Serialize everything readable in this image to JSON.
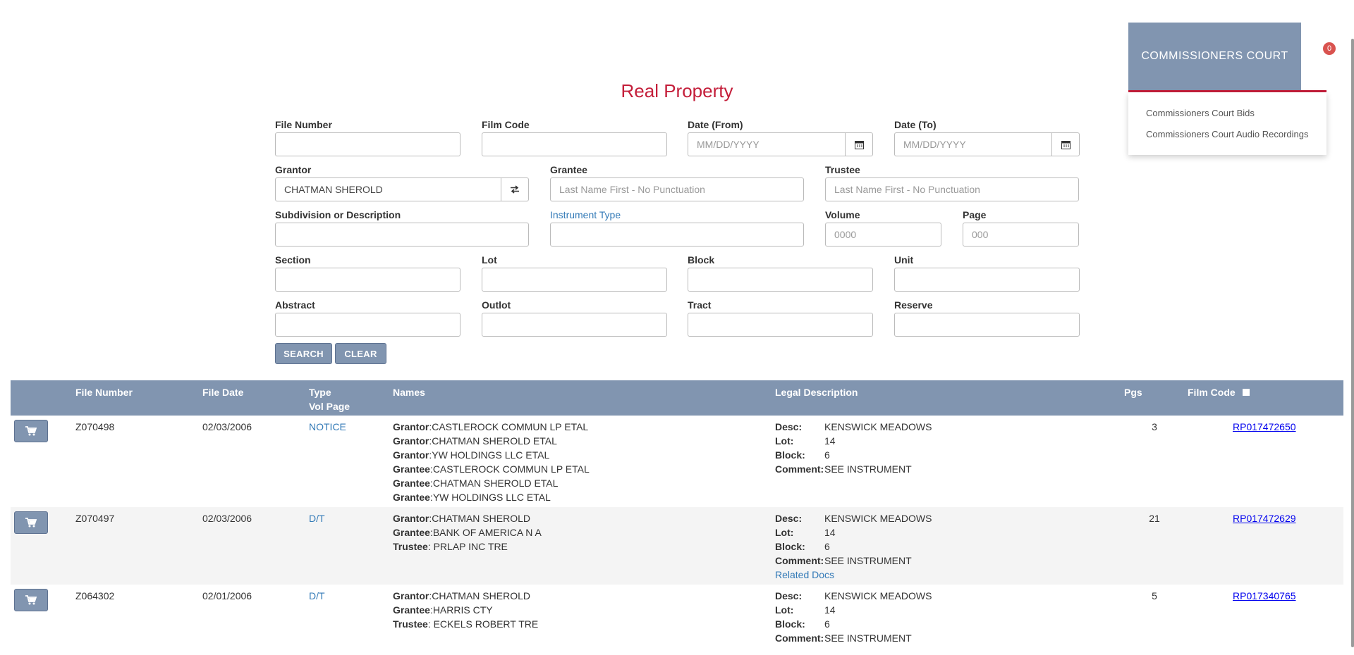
{
  "header": {
    "menu_label": "COMMISSIONERS COURT",
    "badge_count": "0",
    "dropdown_items": [
      "Commissioners Court Bids",
      "Commissioners Court Audio Recordings"
    ]
  },
  "page_title": "Real Property",
  "form": {
    "file_number": {
      "label": "File Number",
      "value": ""
    },
    "film_code": {
      "label": "Film Code",
      "value": ""
    },
    "date_from": {
      "label": "Date (From)",
      "placeholder": "MM/DD/YYYY"
    },
    "date_to": {
      "label": "Date (To)",
      "placeholder": "MM/DD/YYYY"
    },
    "grantor": {
      "label": "Grantor",
      "value": "CHATMAN SHEROLD"
    },
    "grantee": {
      "label": "Grantee",
      "placeholder": "Last Name First - No Punctuation"
    },
    "trustee": {
      "label": "Trustee",
      "placeholder": "Last Name First - No Punctuation"
    },
    "subdivision": {
      "label": "Subdivision or Description",
      "value": ""
    },
    "instrument_type": {
      "label": "Instrument Type",
      "value": ""
    },
    "volume": {
      "label": "Volume",
      "placeholder": "0000"
    },
    "page": {
      "label": "Page",
      "placeholder": "000"
    },
    "section": {
      "label": "Section"
    },
    "lot": {
      "label": "Lot"
    },
    "block": {
      "label": "Block"
    },
    "unit": {
      "label": "Unit"
    },
    "abstract": {
      "label": "Abstract"
    },
    "outlot": {
      "label": "Outlot"
    },
    "tract": {
      "label": "Tract"
    },
    "reserve": {
      "label": "Reserve"
    },
    "search_label": "SEARCH",
    "clear_label": "CLEAR"
  },
  "table": {
    "headers": {
      "file_number": "File Number",
      "file_date": "File Date",
      "type": "Type",
      "vol_page": "Vol Page",
      "names": "Names",
      "legal_description": "Legal Description",
      "pgs": "Pgs",
      "film_code": "Film Code"
    },
    "rows": [
      {
        "file_number": "Z070498",
        "file_date": "02/03/2006",
        "type": "NOTICE",
        "names": [
          {
            "role": "Grantor",
            "sep": ":",
            "name": "CASTLEROCK COMMUN LP ETAL"
          },
          {
            "role": "Grantor",
            "sep": ":",
            "name": "CHATMAN SHEROLD ETAL"
          },
          {
            "role": "Grantor",
            "sep": ":",
            "name": "YW HOLDINGS LLC ETAL"
          },
          {
            "role": "Grantee",
            "sep": ":",
            "name": "CASTLEROCK COMMUN LP ETAL"
          },
          {
            "role": "Grantee",
            "sep": ":",
            "name": "CHATMAN SHEROLD ETAL"
          },
          {
            "role": "Grantee",
            "sep": ":",
            "name": "YW HOLDINGS LLC ETAL"
          }
        ],
        "legal": [
          {
            "label": "Desc:",
            "value": "KENSWICK MEADOWS"
          },
          {
            "label": "Lot:",
            "value": "14"
          },
          {
            "label": "Block:",
            "value": "6"
          },
          {
            "label": "Comment:",
            "value": "SEE INSTRUMENT"
          }
        ],
        "related": "",
        "pgs": "3",
        "film_code": "RP017472650"
      },
      {
        "file_number": "Z070497",
        "file_date": "02/03/2006",
        "type": "D/T",
        "names": [
          {
            "role": "Grantor",
            "sep": ":",
            "name": "CHATMAN SHEROLD"
          },
          {
            "role": "Grantee",
            "sep": ":",
            "name": "BANK OF AMERICA N A"
          },
          {
            "role": "Trustee",
            "sep": ": ",
            "name": "PRLAP INC TRE"
          }
        ],
        "legal": [
          {
            "label": "Desc:",
            "value": "KENSWICK MEADOWS"
          },
          {
            "label": "Lot:",
            "value": "14"
          },
          {
            "label": "Block:",
            "value": "6"
          },
          {
            "label": "Comment:",
            "value": "SEE INSTRUMENT"
          }
        ],
        "related": "Related Docs",
        "pgs": "21",
        "film_code": "RP017472629"
      },
      {
        "file_number": "Z064302",
        "file_date": "02/01/2006",
        "type": "D/T",
        "names": [
          {
            "role": "Grantor",
            "sep": ":",
            "name": "CHATMAN SHEROLD"
          },
          {
            "role": "Grantee",
            "sep": ":",
            "name": "HARRIS CTY"
          },
          {
            "role": "Trustee",
            "sep": ": ",
            "name": "ECKELS ROBERT TRE"
          }
        ],
        "legal": [
          {
            "label": "Desc:",
            "value": "KENSWICK MEADOWS"
          },
          {
            "label": "Lot:",
            "value": "14"
          },
          {
            "label": "Block:",
            "value": "6"
          },
          {
            "label": "Comment:",
            "value": "SEE INSTRUMENT"
          }
        ],
        "related": "",
        "pgs": "5",
        "film_code": "RP017340765"
      }
    ]
  },
  "colors": {
    "accent_red": "#c41e3a",
    "header_blue": "#8195b0",
    "link_blue": "#337ab7"
  }
}
